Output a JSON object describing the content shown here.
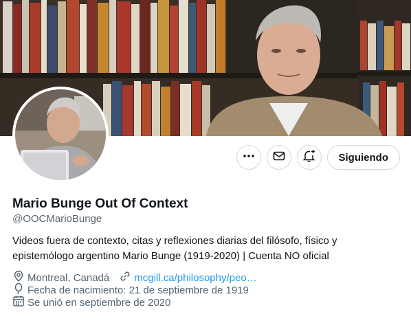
{
  "profile": {
    "display_name": "Mario Bunge Out Of Context",
    "handle": "@OOCMarioBunge",
    "bio_line1": "Videos fuera de contexto, citas y reflexiones diarias del filósofo, físico y",
    "bio_line2": "epistemólogo argentino Mario Bunge (1919-2020) | Cuenta NO oficial",
    "location": "Montreal, Canadá",
    "website": "mcgill.ca/philosophy/peo…",
    "birth_date": "Fecha de nacimiento: 21 de septiembre de 1919",
    "joined": "Se unió en septiembre de 2020"
  },
  "actions": {
    "more_icon": "more-dots-icon",
    "message_icon": "envelope-icon",
    "notify_icon": "bell-plus-icon",
    "follow_label": "Siguiendo"
  },
  "colors": {
    "link": "#1d9bf0",
    "secondary_text": "#536471",
    "border": "#cfd9de"
  }
}
